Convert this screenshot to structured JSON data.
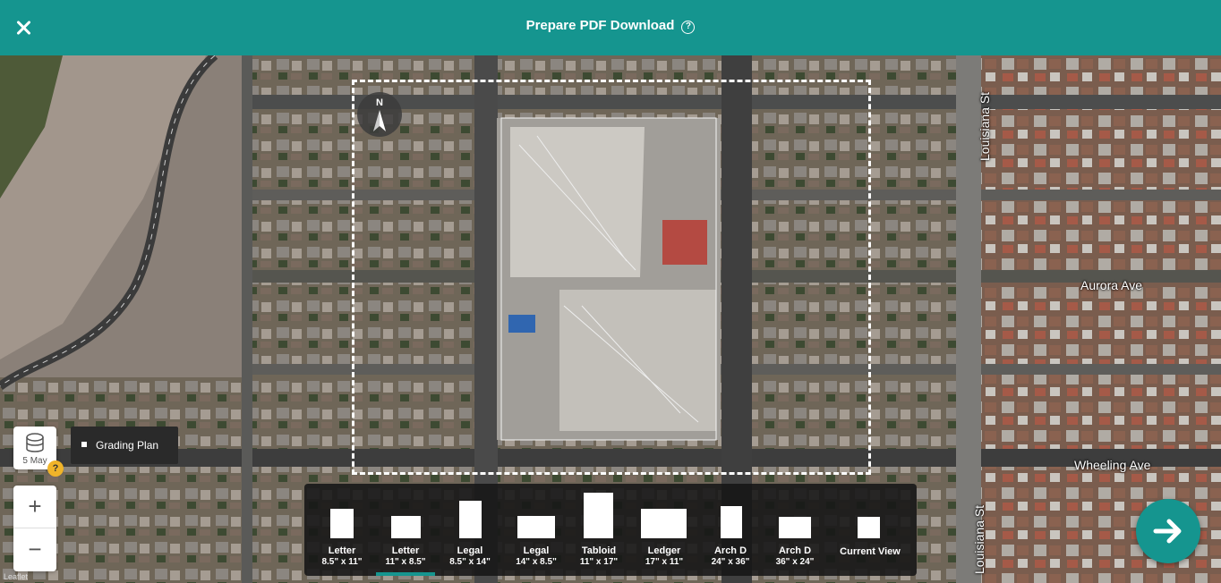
{
  "header": {
    "title": "Prepare PDF Download",
    "help_glyph": "?"
  },
  "map": {
    "streets": {
      "louisiana_top": "Louisiana St",
      "louisiana_bottom": "Louisiana St",
      "aurora": "Aurora Ave",
      "wheeling": "Wheeling Ave"
    },
    "compass_label": "N",
    "attribution": "Leaflet"
  },
  "layer": {
    "date": "5 May",
    "warning_glyph": "?",
    "name": "Grading Plan"
  },
  "zoom": {
    "in_label": "+",
    "out_label": "−"
  },
  "paper_sizes": [
    {
      "name": "Letter",
      "dims": "8.5\" x 11\""
    },
    {
      "name": "Letter",
      "dims": "11\" x 8.5\"",
      "selected": true
    },
    {
      "name": "Legal",
      "dims": "8.5\" x 14\""
    },
    {
      "name": "Legal",
      "dims": "14\" x 8.5\""
    },
    {
      "name": "Tabloid",
      "dims": "11\" x 17\""
    },
    {
      "name": "Ledger",
      "dims": "17\" x 11\""
    },
    {
      "name": "Arch D",
      "dims": "24\" x 36\""
    },
    {
      "name": "Arch D",
      "dims": "36\" x 24\""
    },
    {
      "name": "Current View",
      "dims": ""
    }
  ],
  "colors": {
    "accent": "#15958f",
    "panel": "#161616"
  },
  "icons": {
    "close": "close-icon",
    "help": "help-icon",
    "layers": "layers-icon",
    "next": "arrow-right-icon",
    "compass": "north-arrow-icon"
  }
}
